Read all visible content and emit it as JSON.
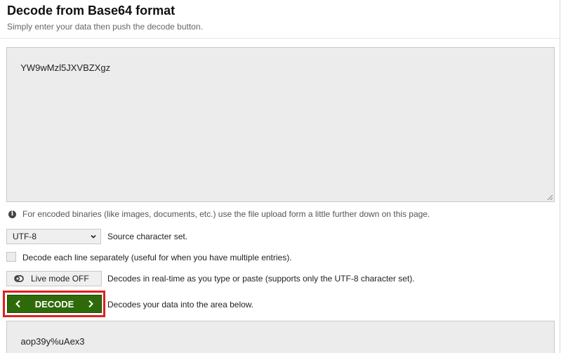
{
  "header": {
    "title": "Decode from Base64 format",
    "subtitle": "Simply enter your data then push the decode button."
  },
  "input": {
    "value": "YW9wMzl5JXVBZXgz"
  },
  "info": {
    "icon": "info-icon",
    "text": "For encoded binaries (like images, documents, etc.) use the file upload form a little further down on this page."
  },
  "charset": {
    "selected": "UTF-8",
    "label": "Source character set."
  },
  "each_line": {
    "checked": false,
    "label": "Decode each line separately (useful for when you have multiple entries)."
  },
  "live_mode": {
    "button_label": "Live mode OFF",
    "description": "Decodes in real-time as you type or paste (supports only the UTF-8 character set)."
  },
  "decode": {
    "button_label": "DECODE",
    "description": "Decodes your data into the area below.",
    "color": "#2f6a0a",
    "highlight_color": "#e0201c"
  },
  "output": {
    "value": "aop39y%uAex3"
  }
}
